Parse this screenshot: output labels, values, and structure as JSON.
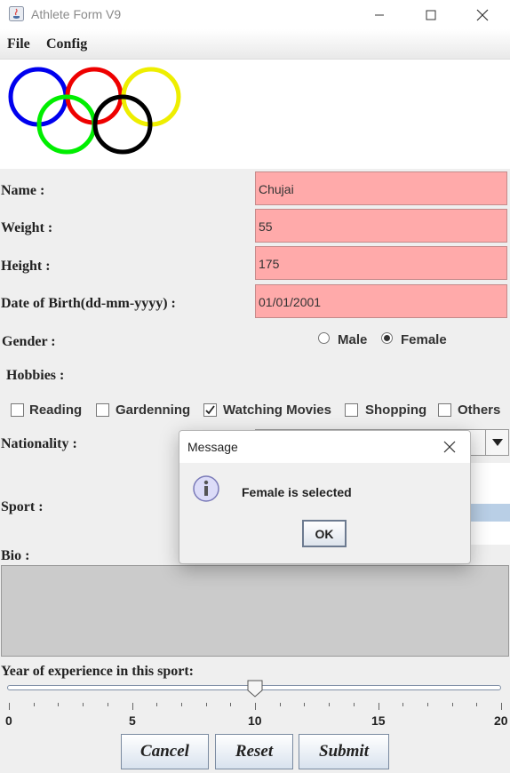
{
  "window": {
    "title": "Athlete Form V9"
  },
  "menu": {
    "file": "File",
    "config": "Config"
  },
  "form": {
    "name_label": "Name :",
    "name_value": "Chujai",
    "weight_label": "Weight :",
    "weight_value": "55",
    "height_label": "Height :",
    "height_value": "175",
    "dob_label": "Date of Birth(dd-mm-yyyy) :",
    "dob_value": "01/01/2001",
    "gender_label": "Gender :",
    "gender_options": [
      "Male",
      "Female"
    ],
    "gender_selected": "Female",
    "hobbies_label": "Hobbies :",
    "hobbies": [
      {
        "label": "Reading",
        "checked": false
      },
      {
        "label": "Gardenning",
        "checked": false
      },
      {
        "label": "Watching Movies",
        "checked": true
      },
      {
        "label": "Shopping",
        "checked": false
      },
      {
        "label": "Others",
        "checked": false
      }
    ],
    "nationality_label": "Nationality :",
    "sport_label": "Sport :",
    "bio_label": "Bio :",
    "experience_label": "Year of experience in this sport:",
    "experience": {
      "min": 0,
      "max": 20,
      "value": 10,
      "major_ticks": [
        "0",
        "5",
        "10",
        "15",
        "20"
      ]
    }
  },
  "buttons": {
    "cancel": "Cancel",
    "reset": "Reset",
    "submit": "Submit"
  },
  "dialog": {
    "title": "Message",
    "message": "Female is selected",
    "ok": "OK"
  },
  "logo": {
    "name": "olympic-rings",
    "colors": [
      "#0000ee",
      "#ee0000",
      "#eeee00",
      "#00ee00",
      "#000000"
    ]
  }
}
